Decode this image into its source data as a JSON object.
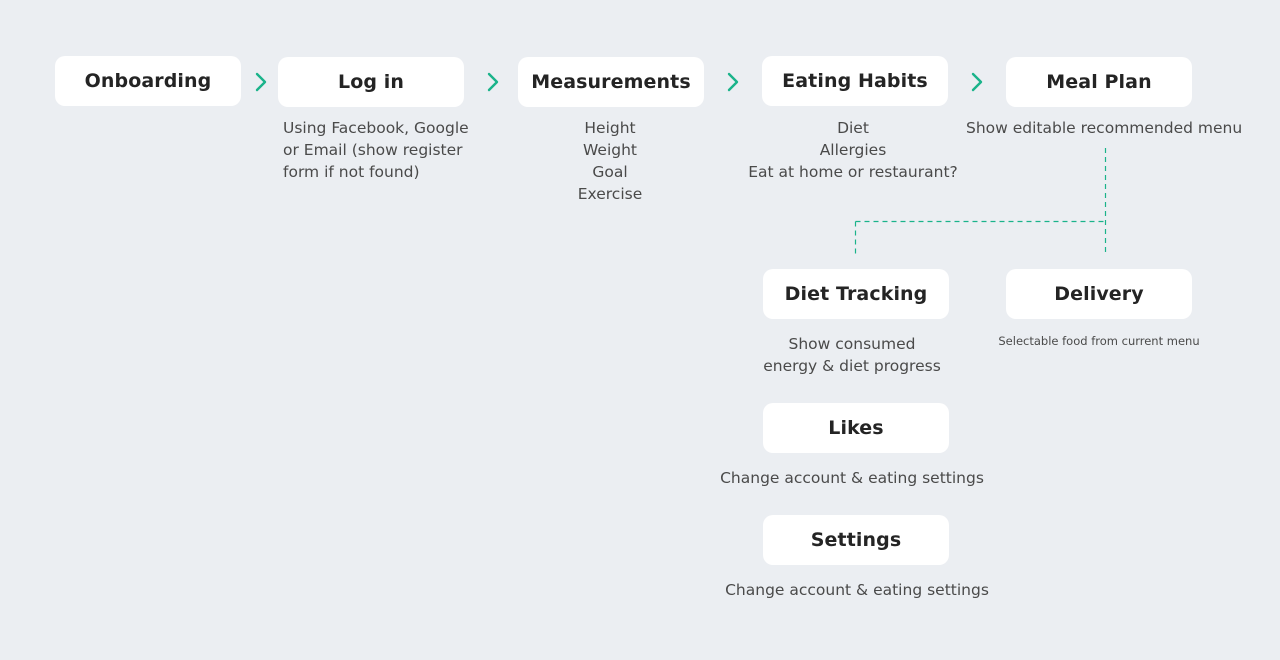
{
  "nodes": {
    "onboarding": "Onboarding",
    "login": "Log in",
    "measurements": "Measurements",
    "eating_habits": "Eating Habits",
    "meal_plan": "Meal Plan",
    "diet_tracking": "Diet Tracking",
    "delivery": "Delivery",
    "likes": "Likes",
    "settings": "Settings"
  },
  "descriptions": {
    "login": [
      "Using Facebook, Google",
      "or Email (show register",
      "form if not found)"
    ],
    "measurements": [
      "Height",
      "Weight",
      "Goal",
      "Exercise"
    ],
    "eating_habits": [
      "Diet",
      "Allergies",
      "Eat at home or restaurant?"
    ],
    "meal_plan": [
      "Show editable recommended menu"
    ],
    "diet_tracking": [
      "Show consumed",
      "energy & diet progress"
    ],
    "delivery": [
      "Selectable food from current menu"
    ],
    "likes": [
      "Change account & eating settings"
    ],
    "settings": [
      "Change account & eating settings"
    ]
  },
  "colors": {
    "background": "#ebeef2",
    "accent": "#1ab38a",
    "node_bg": "#ffffff",
    "node_text": "#242424",
    "desc_text": "#4a4a4a"
  },
  "icons": {
    "flow_arrow": "chevron-right-icon",
    "branch_connector": "dashed-connector"
  }
}
